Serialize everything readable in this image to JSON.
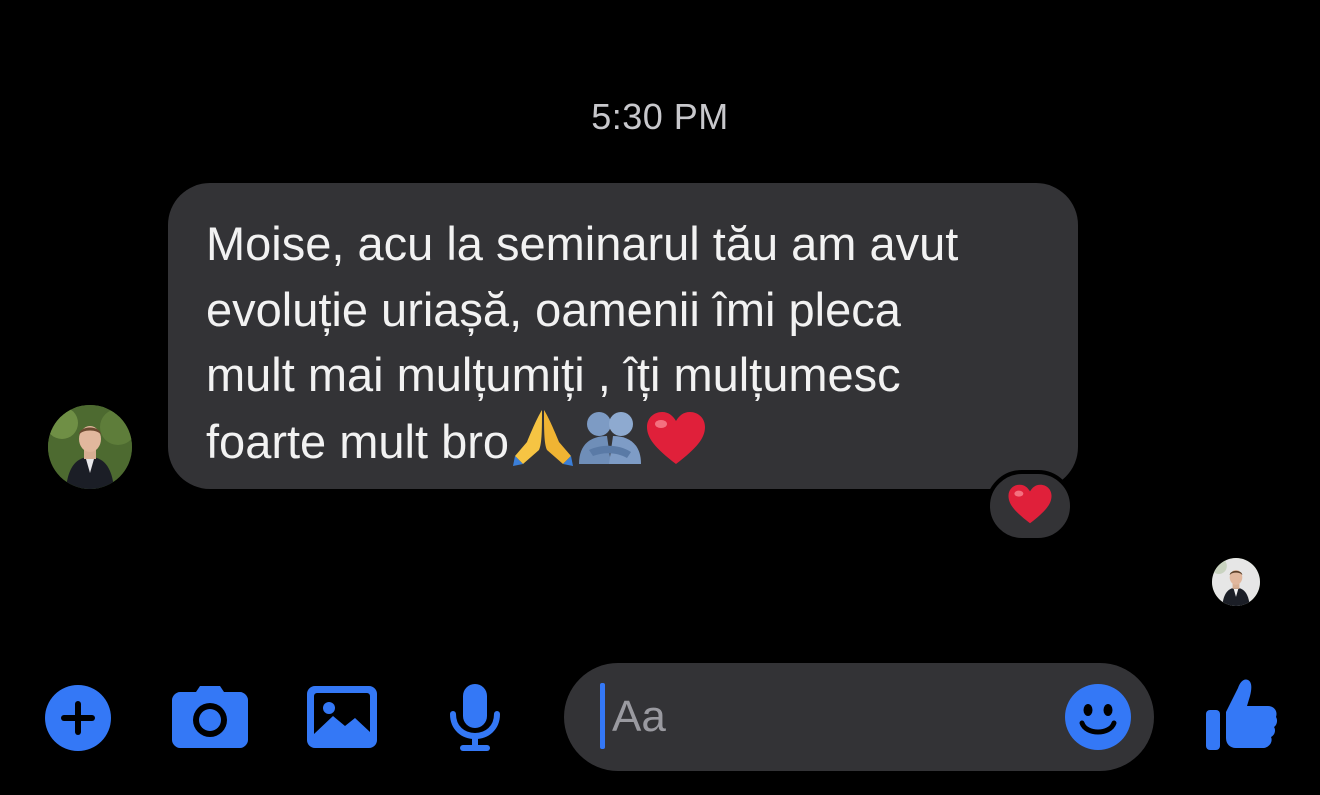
{
  "conversation": {
    "timestamp": "5:30 PM",
    "message": {
      "text": "Moise, acu la seminarul tău am avut\nevoluție uriașă, oamenii îmi pleca\nmult mai mulțumiți , îți mulțumesc\nfoarte mult bro",
      "trailing_emojis": [
        "folded-hands",
        "people-hugging",
        "red-heart"
      ],
      "reaction": "red-heart"
    }
  },
  "composer": {
    "placeholder": "Aa"
  },
  "colors": {
    "background": "#000000",
    "bubble": "#333336",
    "accent": "#3478f6",
    "heart": "#e0203a"
  },
  "icons": {
    "add": "plus-circle-icon",
    "camera": "camera-icon",
    "gallery": "photo-icon",
    "voice": "microphone-icon",
    "emoji": "smile-icon",
    "like": "thumbs-up-icon"
  }
}
